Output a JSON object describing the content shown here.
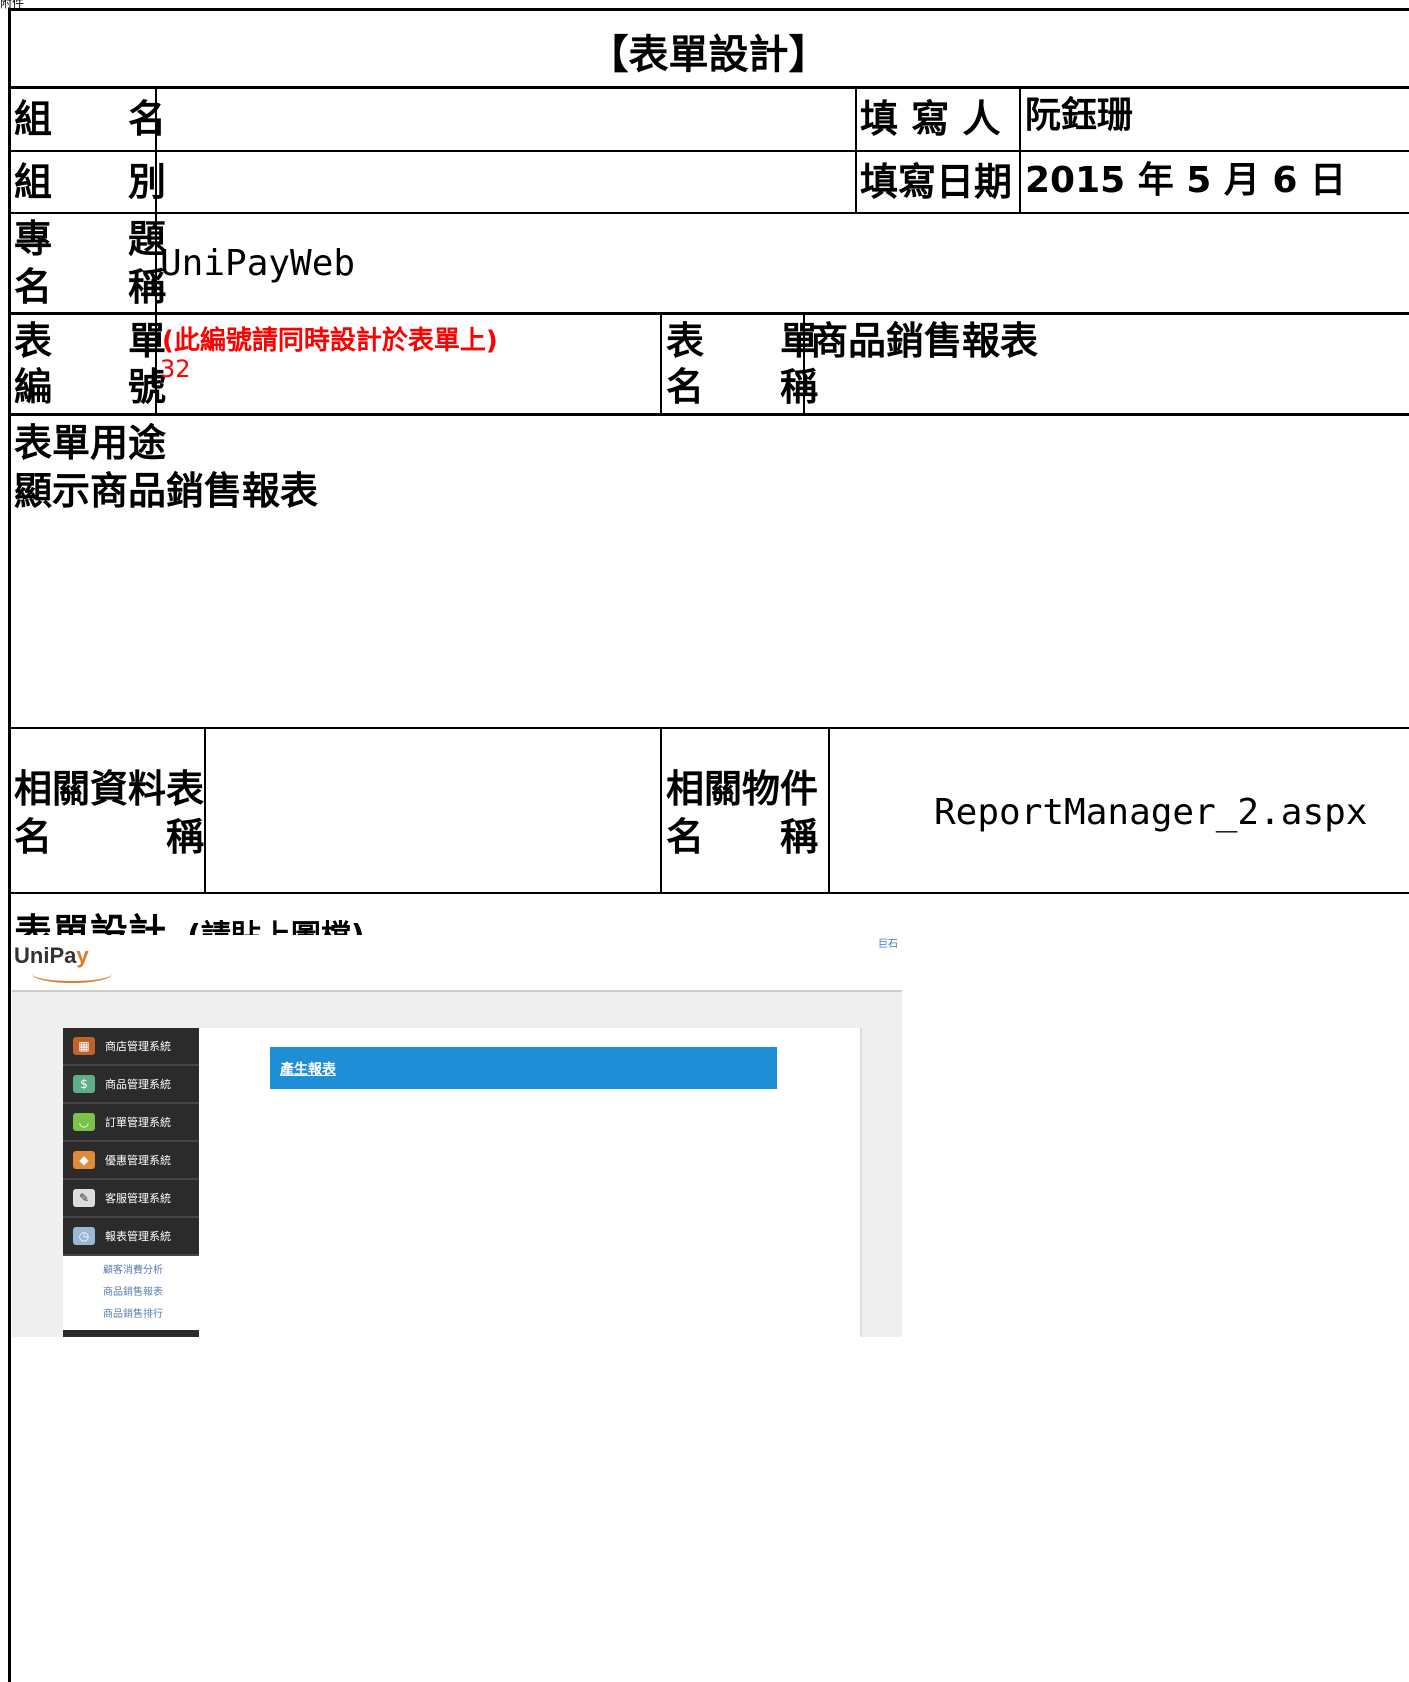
{
  "corner_text": "附件",
  "title": "【表單設計】",
  "row1": {
    "group_name_label": "組　　名",
    "group_name_value": "",
    "filler_label": "填 寫 人",
    "filler_value": "阮鈺珊"
  },
  "row2": {
    "group_label": "組　　別",
    "group_value": "",
    "date_label": "填寫日期",
    "date_value": "2015 年 5 月 6 日"
  },
  "row3": {
    "topic_label_top": "專　　題",
    "topic_label_bottom": "名　　稱",
    "topic_value": "UniPayWeb"
  },
  "row4": {
    "form_no_label_top": "表　　單",
    "form_no_label_bottom": "編　　號",
    "form_no_note": "(此編號請同時設計於表單上)",
    "form_no_value": "32",
    "form_name_label_top": "表　　單",
    "form_name_label_bottom": "名　　稱",
    "form_name_value": "商品銷售報表"
  },
  "purpose": {
    "label": "表單用途",
    "value": "顯示商品銷售報表"
  },
  "related": {
    "table_label_top": "相關資料表",
    "table_label_bottom": "名　　　稱",
    "table_value": "",
    "object_label_top": "相關物件",
    "object_label_bottom": "名　　稱",
    "object_value": "ReportManager_2.aspx"
  },
  "design": {
    "label": "表單設計",
    "note": "(請貼上圖檔)"
  },
  "screenshot": {
    "logo": "UniPa",
    "logo_tail": "y",
    "top_link": "巨石",
    "menu": [
      {
        "label": "商店管理系統",
        "icon": "shop-icon",
        "icon_color": "#c0632b"
      },
      {
        "label": "商品管理系統",
        "icon": "bag-icon",
        "icon_color": "#5fae8a"
      },
      {
        "label": "訂單管理系統",
        "icon": "basket-icon",
        "icon_color": "#7cc24a"
      },
      {
        "label": "優惠管理系統",
        "icon": "tag-icon",
        "icon_color": "#e08a3a"
      },
      {
        "label": "客服管理系統",
        "icon": "note-icon",
        "icon_color": "#dddddd"
      },
      {
        "label": "報表管理系統",
        "icon": "report-icon",
        "icon_color": "#9bb7d6"
      }
    ],
    "submenu": [
      "顧客消費分析",
      "商品銷售報表",
      "商品銷售排行"
    ],
    "bar_label": "產生報表",
    "bar_color": "#1e8fd6"
  }
}
